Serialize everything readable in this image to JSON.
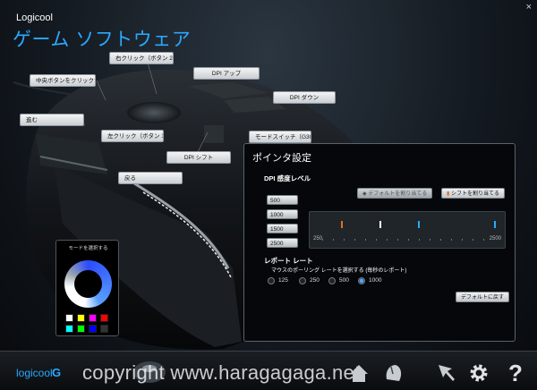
{
  "window": {
    "close_label": "×"
  },
  "header": {
    "brand": "Logicool",
    "title": "ゲーム ソフトウェア"
  },
  "callouts": [
    {
      "id": "right-click",
      "label": "右クリック（ボタン 2）"
    },
    {
      "id": "dpi-up",
      "label": "DPI アップ"
    },
    {
      "id": "middle-click",
      "label": "中央ボタンをクリックする (f"
    },
    {
      "id": "dpi-down",
      "label": "DPI ダウン"
    },
    {
      "id": "forward",
      "label": "進む"
    },
    {
      "id": "left-click",
      "label": "左クリック（ボタン 1）"
    },
    {
      "id": "mode-switch",
      "label": "モードスイッチ（G300/bk）"
    },
    {
      "id": "dpi-shift",
      "label": "DPI シフト"
    },
    {
      "id": "back",
      "label": "戻る"
    }
  ],
  "mode_panel": {
    "title": "モードを選択する",
    "swatches": [
      "#ffffff",
      "#ffff00",
      "#ff00ff",
      "#ff0000",
      "#00ffff",
      "#00ff00",
      "#0000ff",
      "#333333"
    ]
  },
  "pointer_panel": {
    "title": "ポインタ設定",
    "dpi_heading": "DPI 感度レベル",
    "default_button": "デフォルトを割り当てる",
    "shift_button": "シフトを割り当てる",
    "dpi_levels": [
      "500",
      "1000",
      "1500",
      "2500"
    ],
    "slider": {
      "min_label": "250",
      "max_label": "2500",
      "min": 250,
      "max": 2500,
      "markers": [
        {
          "value": 500,
          "color": "#e07020"
        },
        {
          "value": 1000,
          "color": "#ffffff"
        },
        {
          "value": 1500,
          "color": "#2aa9ff"
        },
        {
          "value": 2500,
          "color": "#2aa9ff"
        }
      ]
    },
    "report_heading": "レポート レート",
    "report_sub": "マウスのポーリング レートを選択する (毎秒のレポート)",
    "rates": [
      "125",
      "250",
      "500",
      "1000"
    ],
    "selected_rate": "1000",
    "reset_button": "デフォルトに戻す"
  },
  "bottom_bar": {
    "logo_text": "logicool",
    "logo_mark": "G",
    "copyright": "copyright www.haragagaga.net",
    "help_label": "?"
  },
  "colors": {
    "accent": "#2aa9ff"
  }
}
